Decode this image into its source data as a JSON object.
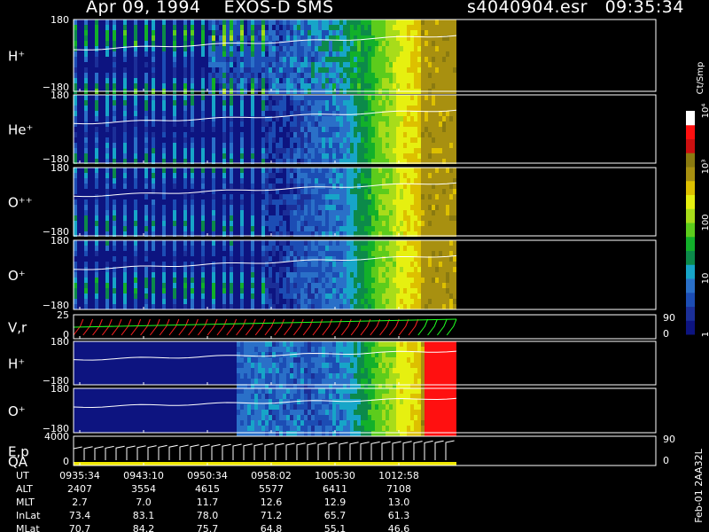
{
  "header": {
    "title": "Apr 09, 1994    EXOS-D SMS",
    "file_time": "s4040904.esr   09:35:34"
  },
  "colors": {
    "background": "#000000",
    "scale": [
      "#0d1480",
      "#1b2f98",
      "#1c4db4",
      "#2a70c8",
      "#17a5c8",
      "#0c8a4a",
      "#12b02a",
      "#5ccc1c",
      "#a8dc1a",
      "#e6f010",
      "#ddc000",
      "#a89010",
      "#8a7a10",
      "#cc1010",
      "#ff1010",
      "#ffffff"
    ]
  },
  "colorbar": {
    "unit": "Ct/Smp",
    "ticks": [
      "10⁴",
      "10³",
      "100",
      "10",
      "1"
    ],
    "tick_values": [
      10000,
      1000,
      100,
      10,
      1
    ]
  },
  "footer": {
    "rows": [
      {
        "label": "UT",
        "values": [
          "0935:34",
          "0943:10",
          "0950:34",
          "0958:02",
          "1005:30",
          "1012:58"
        ]
      },
      {
        "label": "ALT",
        "values": [
          "2407",
          "3554",
          "4615",
          "5577",
          "6411",
          "7108"
        ]
      },
      {
        "label": "MLT",
        "values": [
          "2.7",
          "7.0",
          "11.7",
          "12.6",
          "12.9",
          "13.0"
        ]
      },
      {
        "label": "InLat",
        "values": [
          "73.4",
          "83.1",
          "78.0",
          "71.2",
          "65.7",
          "61.3"
        ]
      },
      {
        "label": "MLat",
        "values": [
          "70.7",
          "84.2",
          "75.7",
          "64.8",
          "55.1",
          "46.6"
        ]
      }
    ],
    "side_text": "Feb-01 2AA32L"
  },
  "chart_data": {
    "type": "heatmap",
    "title": "Apr 09, 1994    EXOS-D SMS",
    "x_ticks": [
      "0935:34",
      "0943:10",
      "0950:34",
      "0958:02",
      "1005:30",
      "1012:58"
    ],
    "panels": [
      {
        "label": "H⁺",
        "y_top": "180",
        "y_bottom": "−180",
        "ylim": [
          -180,
          180
        ],
        "colorscale": "log",
        "clim": [
          1,
          10000
        ]
      },
      {
        "label": "He⁺",
        "y_top": "180",
        "y_bottom": "−180",
        "ylim": [
          -180,
          180
        ],
        "colorscale": "log",
        "clim": [
          1,
          10000
        ]
      },
      {
        "label": "O⁺⁺",
        "y_top": "180",
        "y_bottom": "−180",
        "ylim": [
          -180,
          180
        ],
        "colorscale": "log",
        "clim": [
          1,
          10000
        ]
      },
      {
        "label": "O⁺",
        "y_top": "180",
        "y_bottom": "−180",
        "ylim": [
          -180,
          180
        ],
        "colorscale": "log",
        "clim": [
          1,
          10000
        ]
      },
      {
        "label": "V,r",
        "y_top": "25",
        "y_bottom": "0",
        "ylim": [
          0,
          25
        ],
        "right_top": "90",
        "right_bottom": "0"
      },
      {
        "label": "H⁺",
        "y_top": "180",
        "y_bottom": "−180",
        "ylim": [
          -180,
          180
        ],
        "colorscale": "log",
        "clim": [
          1,
          10000
        ]
      },
      {
        "label": "O⁺",
        "y_top": "180",
        "y_bottom": "−180",
        "ylim": [
          -180,
          180
        ],
        "colorscale": "log",
        "clim": [
          1,
          10000
        ]
      },
      {
        "label": "E,p",
        "label2": "QA",
        "y_top": "4000",
        "y_bottom": "0",
        "ylim": [
          0,
          4000
        ],
        "right_top": "90",
        "right_bottom": "0"
      }
    ]
  }
}
